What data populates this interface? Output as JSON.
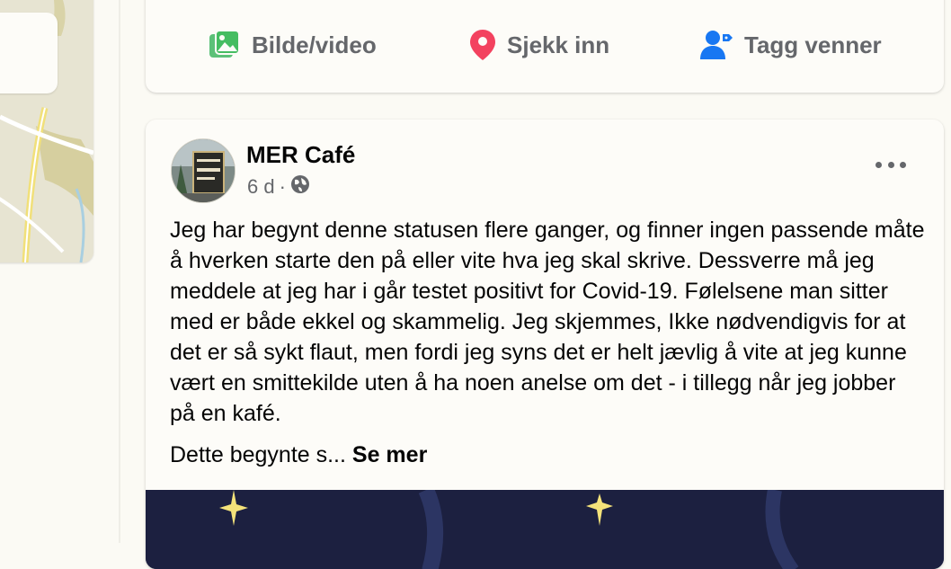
{
  "composer": {
    "actions": [
      {
        "label": "Bilde/video",
        "icon": "photo-video-icon",
        "color": "#45bd62"
      },
      {
        "label": "Sjekk inn",
        "icon": "location-pin-icon",
        "color": "#f3425f"
      },
      {
        "label": "Tagg venner",
        "icon": "tag-friends-icon",
        "color": "#1877f2"
      }
    ]
  },
  "post": {
    "author": "MER Café",
    "time": "6 d",
    "separator": "·",
    "audience_icon": "globe-icon",
    "body": "Jeg har begynt denne statusen flere ganger, og finner ingen passende måte å hverken starte den på eller vite hva jeg skal skrive. Dessverre må jeg meddele at jeg har i går testet positivt for Covid-19. Følelsene man sitter med er både ekkel og skammelig. Jeg skjemmes, Ikke nødvendigvis for at det er så sykt flaut, men fordi jeg syns det er helt jævlig å vite at jeg kunne vært en smittekilde uten å ha noen anelse om det - i tillegg når jeg jobber på en kafé.",
    "teaser": "Dette begynte s...",
    "see_more": "Se mer",
    "menu_icon": "more-options-icon"
  },
  "sidebar": {
    "map_icon": "map-thumbnail"
  }
}
